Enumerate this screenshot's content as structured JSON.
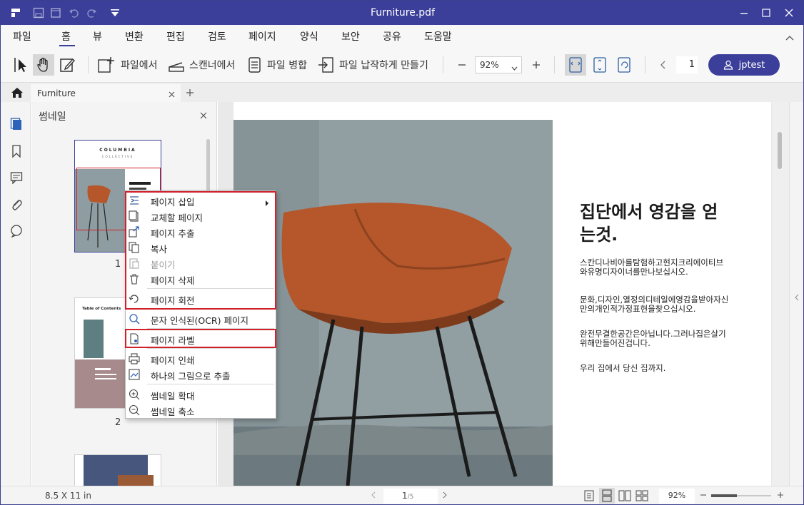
{
  "window": {
    "title": "Furniture.pdf"
  },
  "menu": [
    "파일",
    "홈",
    "뷰",
    "변환",
    "편집",
    "검토",
    "페이지",
    "양식",
    "보안",
    "공유",
    "도움말"
  ],
  "toolbar": {
    "from_file": "파일에서",
    "from_scanner": "스캔너에서",
    "merge": "파일 병합",
    "compress": "파일 납작하게 만들기",
    "zoom": "92%",
    "page_number": "1",
    "user": "jptest"
  },
  "tab": {
    "name": "Furniture"
  },
  "thumbnails": {
    "title": "썸네일",
    "page1_label": "1",
    "page2_label": "2",
    "thumb1_brand": "COLUMBIA",
    "thumb1_sub": "COLLECTIVE",
    "thumb2_title": "Table of Contents"
  },
  "context_menu": {
    "insert": "페이지 삽입",
    "replace": "교체할 페이지",
    "extract": "페이지 추출",
    "copy": "복사",
    "paste": "붙이기",
    "delete": "페이지 삭제",
    "rotate": "페이지 회전",
    "ocr": "문자 인식된(OCR) 페이지",
    "label": "페이지 라벨",
    "print": "페이지 인쇄",
    "extract_image": "하나의 그림으로 추출",
    "zoom_in": "썸네일 확대",
    "zoom_out": "썸네일 축소"
  },
  "document": {
    "heading": "집단에서 영감을 얻는것.",
    "para1": "스칸디나비아를탐험하고현지크리에이티브와유명디자이너를만나보십시오.",
    "para2": "문화,디자인,열정의디테일에영감을받아자신만의개인적가정표현을찾으십시오.",
    "para3": "완전무결한공간은아닙니다.그러나집은살기위해만들어진겁니다.",
    "para4": "우리 집에서 당신 집까지."
  },
  "status": {
    "page_size": "8.5 X 11 in",
    "page_indicator": "1",
    "page_total": "/5",
    "zoom": "92%"
  },
  "colors": {
    "accent": "#3b3f9a",
    "highlight": "#d0202a",
    "chair": "#b5572a"
  }
}
